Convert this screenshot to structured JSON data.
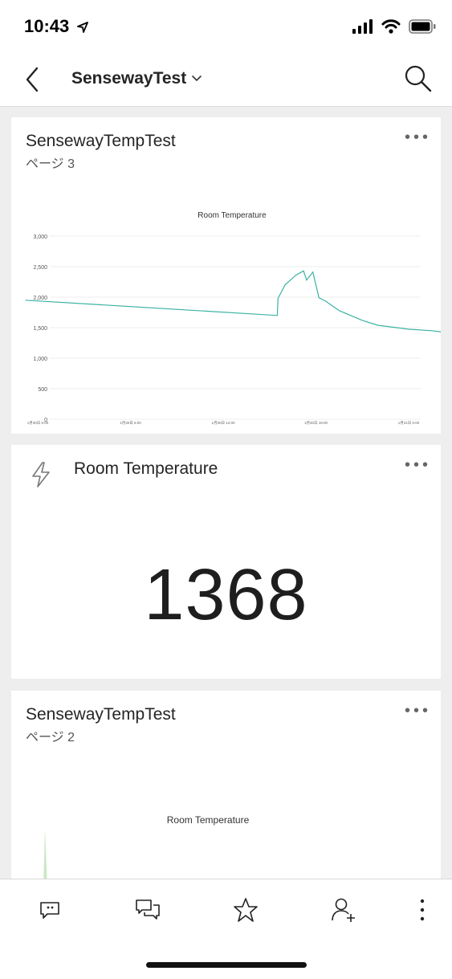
{
  "status_bar": {
    "time": "10:43"
  },
  "header": {
    "title": "SensewayTest"
  },
  "tiles": [
    {
      "title": "SensewayTempTest",
      "subtitle": "ページ 3",
      "more": "•••",
      "chart_data": {
        "type": "line",
        "title": "Room Temperature",
        "ylim": [
          0,
          3000
        ],
        "yticks": [
          "3,000",
          "2,500",
          "2,000",
          "1,500",
          "1,000",
          "500",
          "0"
        ],
        "xticks": [
          "1月30日 0:00",
          "1月30日 6:00",
          "1月30日 12:00",
          "1月30日 18:00",
          "1月31日 0:00"
        ],
        "xlim_hours": [
          0,
          24
        ],
        "series": [
          {
            "color": "#3bb3a3",
            "points": [
              [
                -0.8,
                1950
              ],
              [
                15.5,
                1700
              ],
              [
                15.55,
                1980
              ],
              [
                16.0,
                2200
              ],
              [
                16.7,
                2360
              ],
              [
                17.2,
                2430
              ],
              [
                17.4,
                2280
              ],
              [
                17.8,
                2410
              ],
              [
                18.2,
                1990
              ],
              [
                18.6,
                1940
              ],
              [
                19.5,
                1780
              ],
              [
                21,
                1620
              ],
              [
                22,
                1540
              ],
              [
                24,
                1475
              ],
              [
                25.5,
                1450
              ],
              [
                26.5,
                1420
              ],
              [
                27.2,
                1400
              ],
              [
                27.6,
                1450
              ],
              [
                28,
                1420
              ],
              [
                28.6,
                1430
              ],
              [
                29,
                1400
              ]
            ]
          }
        ]
      }
    },
    {
      "title": "Room Temperature",
      "more": "•••",
      "value": "1368"
    },
    {
      "title": "SensewayTempTest",
      "subtitle": "ページ 2",
      "more": "•••",
      "chart_title": "Room Temperature"
    }
  ],
  "icons": {
    "back": "chevron-left-icon",
    "title_dropdown": "chevron-down-icon",
    "search": "search-icon",
    "tile_action": "lightning-bolt-icon",
    "bottom_bar": [
      "comment-icon",
      "conversations-icon",
      "favorite-star-icon",
      "share-person-icon",
      "more-vertical-icon"
    ]
  },
  "colors": {
    "line": "#3bb3a3",
    "spike": "#c9e8c2",
    "background": "#eeeeee"
  }
}
